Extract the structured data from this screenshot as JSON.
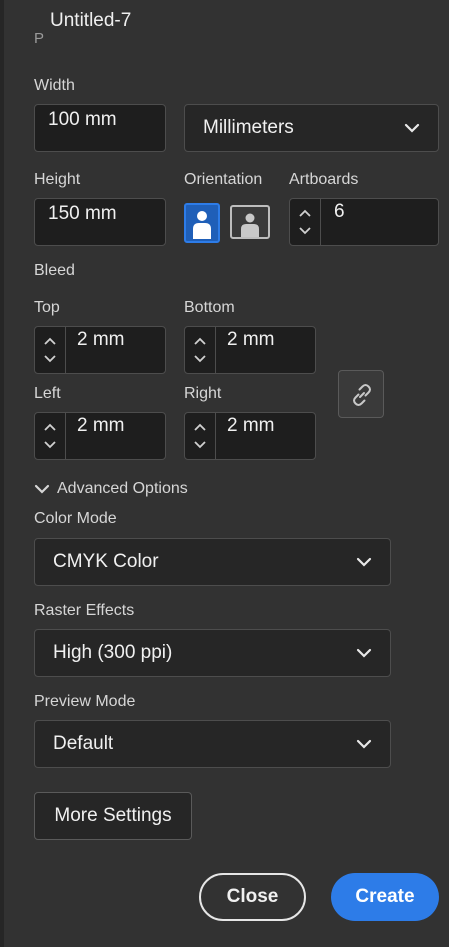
{
  "document": {
    "name": "Untitled-7",
    "preset_partial": "P"
  },
  "width": {
    "label": "Width",
    "value": "100 mm"
  },
  "units": {
    "selected": "Millimeters"
  },
  "height": {
    "label": "Height",
    "value": "150 mm"
  },
  "orientation": {
    "label": "Orientation",
    "selected": "portrait"
  },
  "artboards": {
    "label": "Artboards",
    "value": "6"
  },
  "bleed": {
    "label": "Bleed",
    "top": {
      "label": "Top",
      "value": "2 mm"
    },
    "bottom": {
      "label": "Bottom",
      "value": "2 mm"
    },
    "left": {
      "label": "Left",
      "value": "2 mm"
    },
    "right": {
      "label": "Right",
      "value": "2 mm"
    },
    "link_icon": "link-icon"
  },
  "advanced": {
    "label": "Advanced Options",
    "color_mode": {
      "label": "Color Mode",
      "value": "CMYK Color"
    },
    "raster_effects": {
      "label": "Raster Effects",
      "value": "High (300 ppi)"
    },
    "preview_mode": {
      "label": "Preview Mode",
      "value": "Default"
    }
  },
  "buttons": {
    "more_settings": "More Settings",
    "close": "Close",
    "create": "Create"
  },
  "colors": {
    "panel_bg": "#323232",
    "accent_blue": "#2d7ce8",
    "field_bg": "#1e1e1e"
  }
}
